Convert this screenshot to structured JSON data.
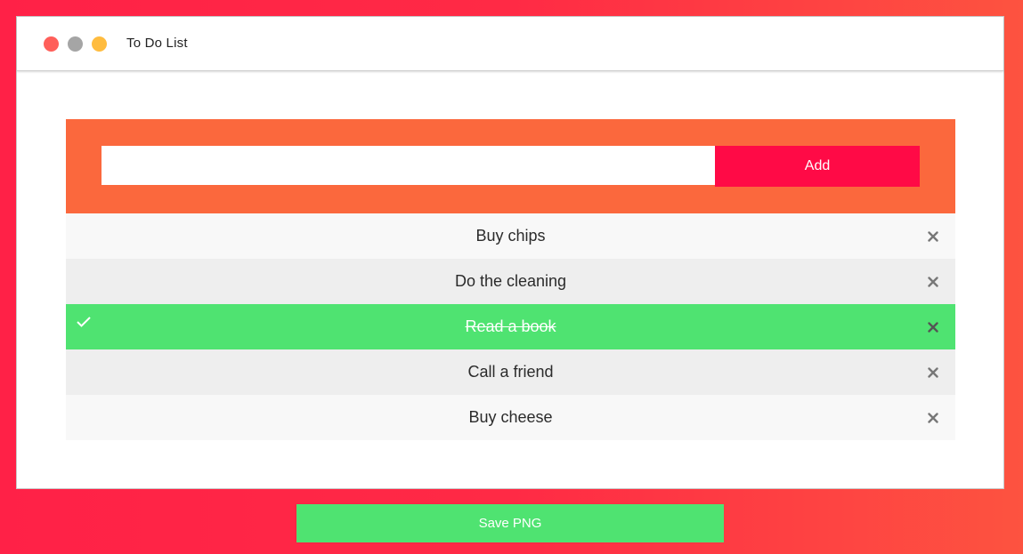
{
  "window": {
    "title": "To Do List",
    "controls": [
      {
        "name": "close-dot",
        "color": "#ff5f5a"
      },
      {
        "name": "minimize-dot",
        "color": "#a5a5a5"
      },
      {
        "name": "maximize-dot",
        "color": "#ffbc3f"
      }
    ]
  },
  "todo": {
    "panel_color": "#fb683d",
    "input": {
      "value": "",
      "placeholder": ""
    },
    "add_label": "Add",
    "add_color": "#ff0a46",
    "tasks": [
      {
        "label": "Buy chips",
        "checked": false
      },
      {
        "label": "Do the cleaning",
        "checked": false
      },
      {
        "label": "Read a book",
        "checked": true
      },
      {
        "label": "Call a friend",
        "checked": false
      },
      {
        "label": "Buy cheese",
        "checked": false
      }
    ],
    "checked_color": "#4fe371",
    "close_icon_color": "#777777",
    "close_icon_checked_color": "#555555",
    "check_icon": "checkmark-icon",
    "remove_icon": "close-icon"
  },
  "save": {
    "label": "Save PNG",
    "color": "#4fe371"
  }
}
